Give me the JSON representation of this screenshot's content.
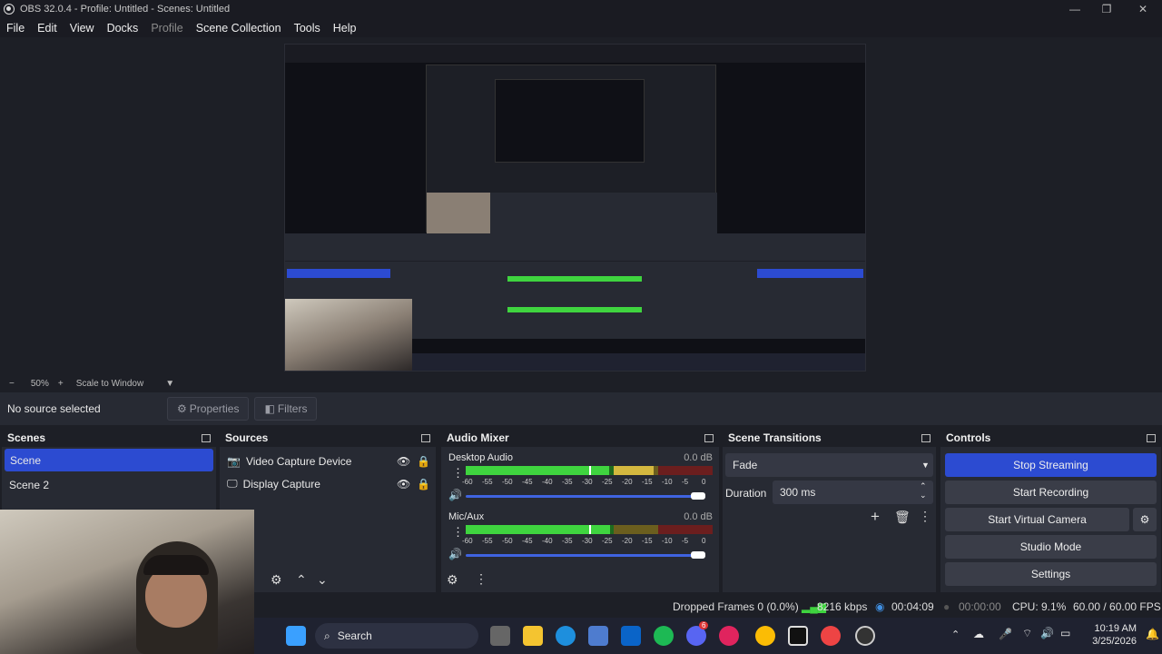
{
  "window": {
    "title": "OBS 32.0.4 - Profile: Untitled - Scenes: Untitled"
  },
  "menu": [
    "File",
    "Edit",
    "View",
    "Docks",
    "Profile",
    "Scene Collection",
    "Tools",
    "Help"
  ],
  "zoom": {
    "minus": "−",
    "level": "50%",
    "plus": "+",
    "mode": "Scale to Window"
  },
  "context": {
    "status": "No source selected",
    "properties": "Properties",
    "filters": "Filters"
  },
  "scenes": {
    "title": "Scenes",
    "items": [
      "Scene",
      "Scene 2"
    ],
    "selected": 0
  },
  "sources": {
    "title": "Sources",
    "items": [
      "Video Capture Device",
      "Display Capture"
    ]
  },
  "mixer": {
    "title": "Audio Mixer",
    "channels": [
      {
        "name": "Desktop Audio",
        "db": "0.0 dB",
        "level": 0.31
      },
      {
        "name": "Mic/Aux",
        "db": "0.0 dB",
        "level": 0.36
      }
    ],
    "ticks": [
      "-60",
      "-55",
      "-50",
      "-45",
      "-40",
      "-35",
      "-30",
      "-25",
      "-20",
      "-15",
      "-10",
      "-5",
      "0"
    ]
  },
  "transitions": {
    "title": "Scene Transitions",
    "selected": "Fade",
    "duration_label": "Duration",
    "duration_value": "300 ms"
  },
  "controls": {
    "title": "Controls",
    "buttons": [
      "Stop Streaming",
      "Start Recording",
      "Start Virtual Camera",
      "Studio Mode",
      "Settings"
    ]
  },
  "status": {
    "dropped": "Dropped Frames 0 (0.0%)",
    "kbps": "8216 kbps",
    "stream_time": "00:04:09",
    "rec_time": "00:00:00",
    "cpu": "CPU: 9.1%",
    "fps": "60.00 / 60.00 FPS"
  },
  "taskbar": {
    "search": "Search",
    "time": "10:19 AM",
    "date": "3/25/2026",
    "badge": "6"
  },
  "colors": {
    "accent": "#2c4bd1",
    "meter_green": "#3fd43f",
    "meter_yellow": "#d4b83f",
    "meter_red": "#c83232"
  }
}
